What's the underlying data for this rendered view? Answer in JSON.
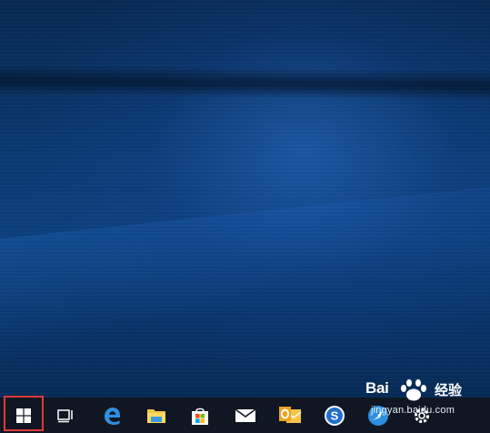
{
  "desktop": {
    "wallpaper": "windows-10-hero"
  },
  "taskbar": {
    "background": "#101722",
    "highlight_color": "#e0383b",
    "items": [
      {
        "name": "start-button",
        "icon": "windows-logo-icon"
      },
      {
        "name": "task-view-button",
        "icon": "task-view-icon"
      },
      {
        "name": "edge-button",
        "icon": "edge-browser-icon"
      },
      {
        "name": "file-explorer-button",
        "icon": "folder-icon"
      },
      {
        "name": "store-button",
        "icon": "store-bag-icon"
      },
      {
        "name": "mail-button",
        "icon": "mail-icon"
      },
      {
        "name": "outlook-button",
        "icon": "outlook-icon"
      },
      {
        "name": "sogou-button",
        "icon": "s-circle-icon"
      },
      {
        "name": "feather-app-button",
        "icon": "feather-icon"
      },
      {
        "name": "settings-button",
        "icon": "gear-icon"
      }
    ]
  },
  "watermark": {
    "brand": "Bai",
    "brand_suffix": "经验",
    "url": "jingyan.baidu.com"
  }
}
